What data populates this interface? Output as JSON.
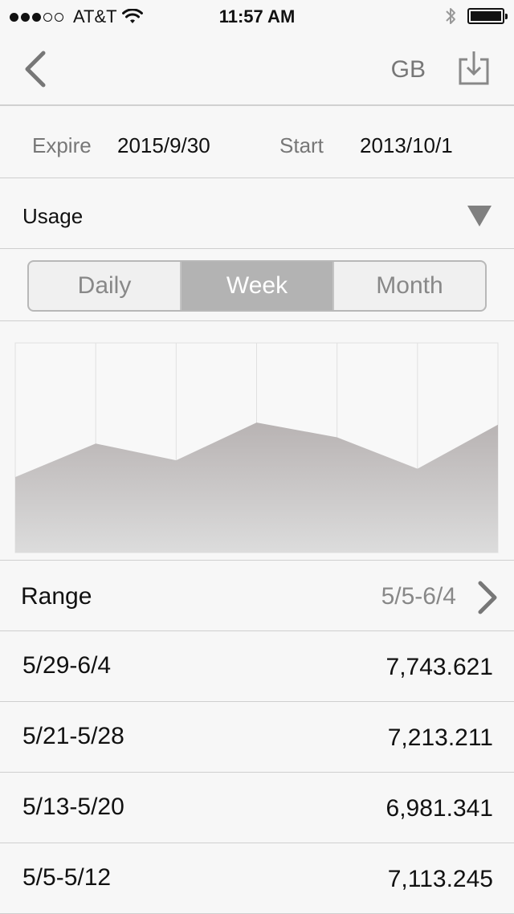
{
  "status_bar": {
    "carrier": "AT&T",
    "time": "11:57 AM",
    "signal_bars_filled": 3,
    "signal_bars_total": 5,
    "battery_level": 1.0,
    "icons": [
      "wifi-icon",
      "bluetooth-icon",
      "battery-icon"
    ]
  },
  "nav": {
    "back_icon": "chevron-left-icon",
    "unit_label": "GB",
    "export_icon": "download-icon"
  },
  "dates": {
    "expire_label": "Expire",
    "expire_value": "2015/9/30",
    "start_label": "Start",
    "start_value": "2013/10/1"
  },
  "usage": {
    "label": "Usage",
    "dropdown_icon": "triangle-down-icon"
  },
  "segments": {
    "items": [
      "Daily",
      "Week",
      "Month"
    ],
    "selected": "Week"
  },
  "range": {
    "label": "Range",
    "value": "5/5-6/4",
    "icon": "chevron-right-icon"
  },
  "rows": [
    {
      "period": "5/29-6/4",
      "amount": "7,743.621"
    },
    {
      "period": "5/21-5/28",
      "amount": "7,213.211"
    },
    {
      "period": "5/13-5/20",
      "amount": "6,981.341"
    },
    {
      "period": "5/5-5/12",
      "amount": "7,113.245"
    }
  ],
  "chart_data": {
    "type": "area",
    "x": [
      0,
      1,
      2,
      3,
      4,
      5,
      6
    ],
    "values": [
      0.36,
      0.52,
      0.44,
      0.62,
      0.55,
      0.4,
      0.61
    ],
    "ylim": [
      0,
      1
    ],
    "grid": true,
    "colors": {
      "fill_top": "#b8b3b3",
      "fill_bottom": "#dcdcdc",
      "grid": "#e0e0e0"
    }
  },
  "colors": {
    "background": "#f7f7f7",
    "segment_active": "#b3b3b3",
    "secondary_text": "#777777"
  }
}
